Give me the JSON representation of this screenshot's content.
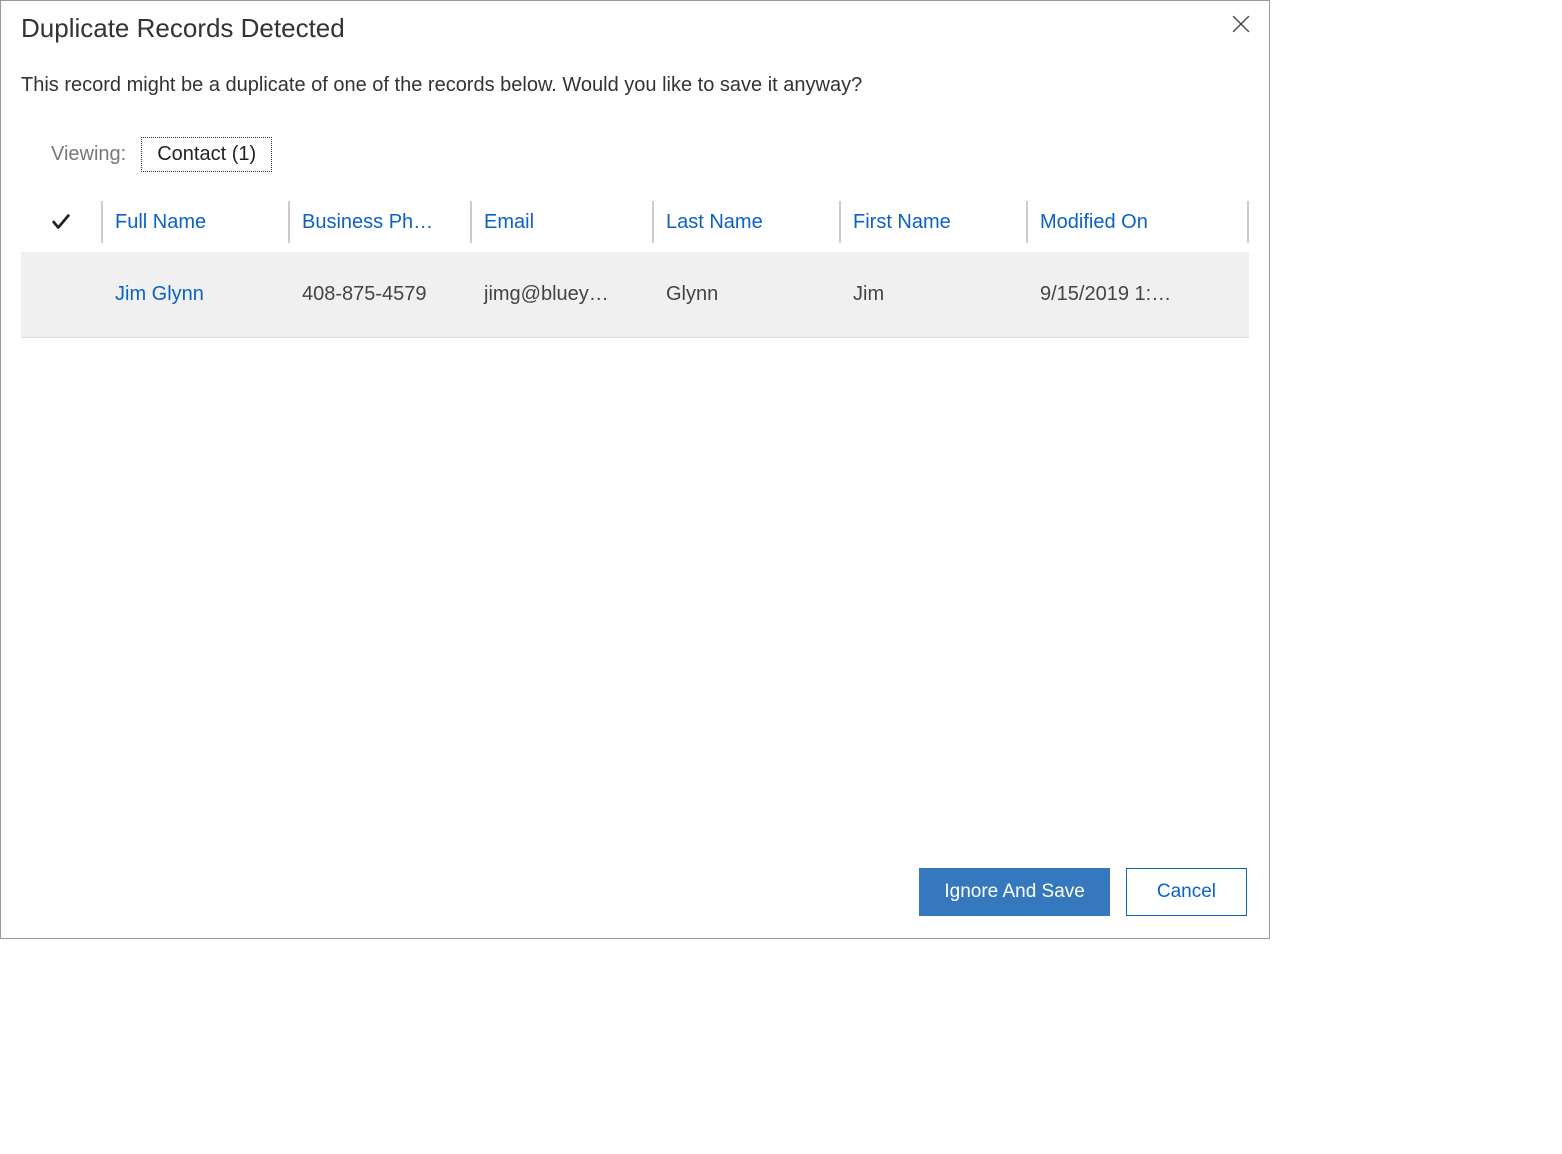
{
  "dialog": {
    "title": "Duplicate Records Detected",
    "message": "This record might be a duplicate of one of the records below. Would you like to save it anyway?",
    "viewing_label": "Viewing:",
    "viewing_value": "Contact (1)"
  },
  "grid": {
    "columns": {
      "full_name": "Full Name",
      "business_phone": "Business Ph…",
      "email": "Email",
      "last_name": "Last Name",
      "first_name": "First Name",
      "modified_on": "Modified On"
    },
    "rows": [
      {
        "full_name": "Jim Glynn",
        "business_phone": "408-875-4579",
        "email": "jimg@bluey…",
        "last_name": "Glynn",
        "first_name": "Jim",
        "modified_on": "9/15/2019 1:…"
      }
    ]
  },
  "footer": {
    "primary": "Ignore And Save",
    "secondary": "Cancel"
  }
}
